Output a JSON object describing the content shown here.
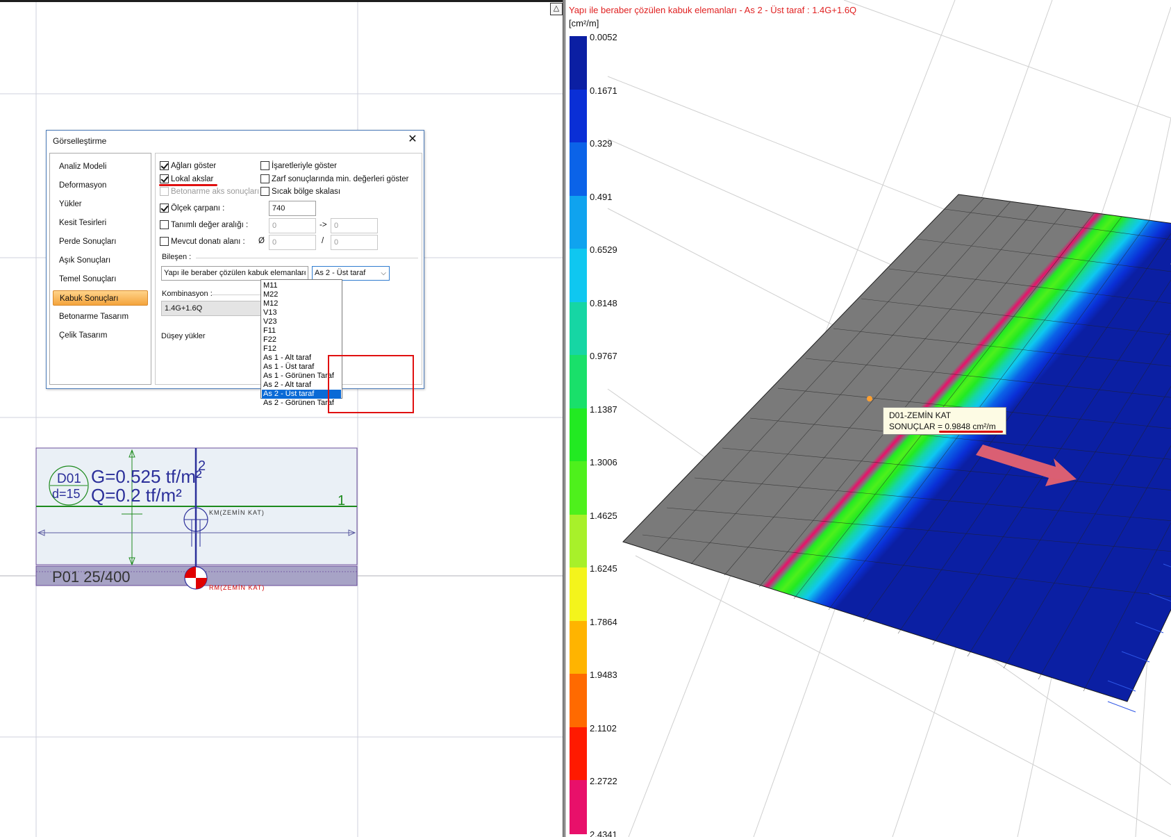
{
  "dialog": {
    "title": "Görselleştirme",
    "close_glyph": "✕",
    "nav": [
      {
        "label": "Analiz Modeli"
      },
      {
        "label": "Deformasyon"
      },
      {
        "label": "Yükler"
      },
      {
        "label": "Kesit Tesirleri"
      },
      {
        "label": "Perde Sonuçları"
      },
      {
        "label": "Aşık Sonuçları"
      },
      {
        "label": "Temel Sonuçları"
      },
      {
        "label": "Kabuk Sonuçları",
        "active": true
      },
      {
        "label": "Betonarme Tasarım"
      },
      {
        "label": "Çelik Tasarım"
      }
    ],
    "options": {
      "show_mesh": {
        "label": "Ağları göster",
        "checked": true
      },
      "local_axes": {
        "label": "Lokal akslar",
        "checked": true
      },
      "rc_axis_results": {
        "label": "Betonarme aks sonuçları",
        "checked": false,
        "disabled": true
      },
      "show_with_signs": {
        "label": "İşaretleriyle göster",
        "checked": false
      },
      "envelope_min": {
        "label": "Zarf sonuçlarında min. değerleri göster",
        "checked": false
      },
      "hot_zone_scale": {
        "label": "Sıcak bölge skalası",
        "checked": false
      },
      "scale_factor": {
        "label": "Ölçek çarpanı :",
        "checked": true,
        "value": "740"
      },
      "value_range": {
        "label": "Tanımlı değer aralığı :",
        "checked": false,
        "from": "0",
        "arrow": "->",
        "to": "0"
      },
      "existing_rebar": {
        "label": "Mevcut donatı alanı :",
        "checked": false,
        "diameter_symbol": "Ø",
        "diameter": "0",
        "slash": "/",
        "spacing": "0"
      }
    },
    "component_label": "Bileşen :",
    "component_element_select": "Yapı ile beraber çözülen kabuk elemanları",
    "component_result_select": "As 2 - Üst taraf",
    "combination_label": "Kombinasyon :",
    "combination_value": "1.4G+1.6Q",
    "load_case_label": "Düşey yükler",
    "dropdown_options": [
      "M11",
      "M22",
      "M12",
      "V13",
      "V23",
      "F11",
      "F22",
      "F12",
      "As 1 - Alt taraf",
      "As 1 - Üst taraf",
      "As 1 - Görünen Taraf",
      "As 2 - Alt taraf",
      "As 2 - Üst taraf",
      "As 2 - Görünen Taraf"
    ],
    "dropdown_selected": "As 2 - Üst taraf"
  },
  "plan": {
    "slab_id": "D01",
    "slab_thickness": "d=15",
    "dead_load": "G=0.525 tf/m²",
    "live_load": "Q=0.2 tf/m²",
    "axis_label_2": "2",
    "axis_label_1": "1",
    "km_label": "KM(ZEMİN KAT)",
    "rm_label": "RM(ZEMİN KAT)",
    "wall_label": "P01 25/400"
  },
  "view3d": {
    "title": "Yapı ile beraber çözülen kabuk elemanları - As 2 - Üst taraf : 1.4G+1.6Q",
    "toggle_glyph": "△",
    "legend_unit": "[cm²/m]",
    "legend": [
      {
        "label": "0.0052",
        "color": "#0b1fa3"
      },
      {
        "label": "0.1671",
        "color": "#0a2fd6"
      },
      {
        "label": "0.329",
        "color": "#0b63e8"
      },
      {
        "label": "0.491",
        "color": "#0fa3ef"
      },
      {
        "label": "0.6529",
        "color": "#0fc7f0"
      },
      {
        "label": "0.8148",
        "color": "#16d6a4"
      },
      {
        "label": "0.9767",
        "color": "#19e06a"
      },
      {
        "label": "1.1387",
        "color": "#22ea22"
      },
      {
        "label": "1.3006",
        "color": "#4ef01c"
      },
      {
        "label": "1.4625",
        "color": "#a8f02a"
      },
      {
        "label": "1.6245",
        "color": "#f4f41c"
      },
      {
        "label": "1.7864",
        "color": "#ffb400"
      },
      {
        "label": "1.9483",
        "color": "#ff6a00"
      },
      {
        "label": "2.1102",
        "color": "#ff1a00"
      },
      {
        "label": "2.2722",
        "color": "#e8106a"
      },
      {
        "label": "2.4341",
        "color": ""
      }
    ],
    "tooltip_line1": "D01-ZEMİN KAT",
    "tooltip_line2": "SONUÇLAR = 0.9848 cm²/m"
  }
}
